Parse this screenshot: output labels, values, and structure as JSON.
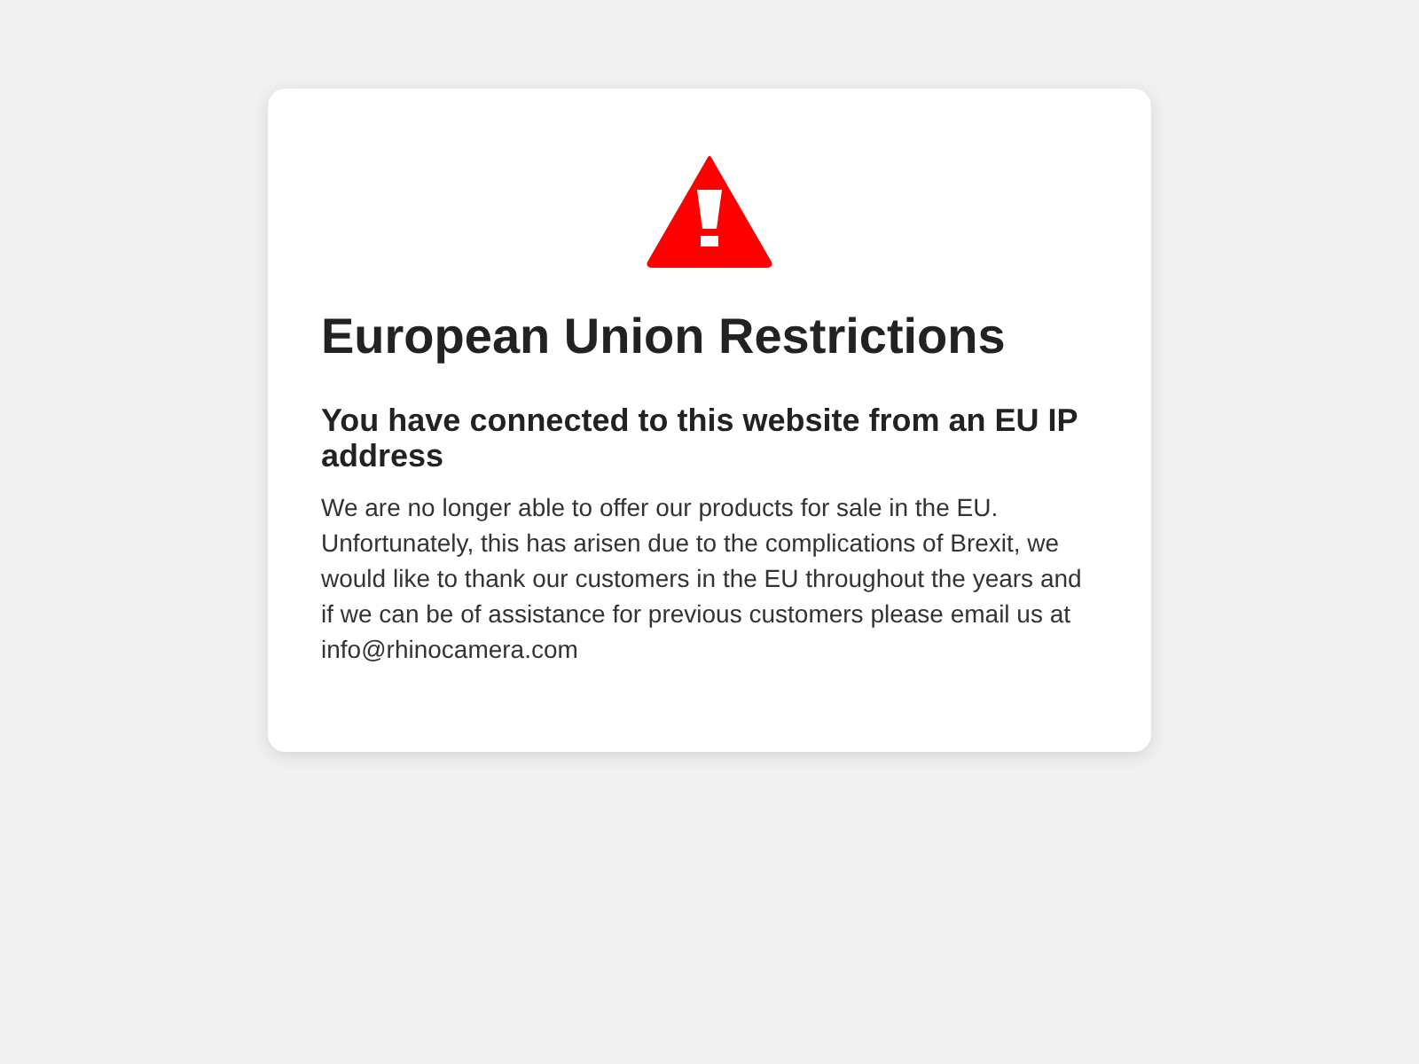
{
  "card": {
    "title": "European Union Restrictions",
    "subtitle": "You have connected to this website from an EU IP address",
    "message": "We are no longer able to offer our products for sale in the EU. Unfortunately, this has arisen due to the complications of Brexit, we would like to thank our customers in the EU throughout the years and if we can be of assistance for previous customers please email us at info@rhinocamera.com"
  }
}
